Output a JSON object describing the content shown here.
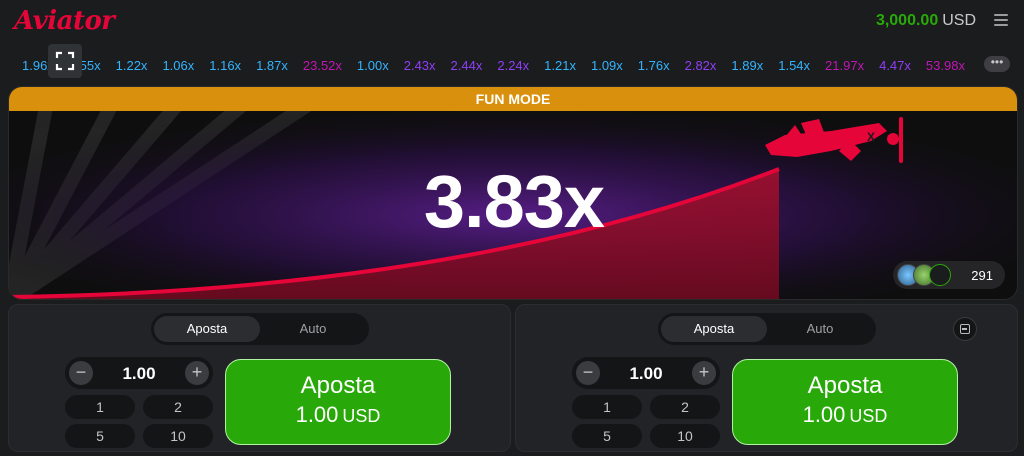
{
  "header": {
    "logo": "Aviator",
    "balance_amount": "3,000.00",
    "balance_currency": "USD"
  },
  "history": [
    {
      "text": "1.96x",
      "color": "#34b4ff"
    },
    {
      "text": "1.55x",
      "color": "#34b4ff"
    },
    {
      "text": "1.22x",
      "color": "#34b4ff"
    },
    {
      "text": "1.06x",
      "color": "#34b4ff"
    },
    {
      "text": "1.16x",
      "color": "#34b4ff"
    },
    {
      "text": "1.87x",
      "color": "#34b4ff"
    },
    {
      "text": "23.52x",
      "color": "#c017b4"
    },
    {
      "text": "1.00x",
      "color": "#34b4ff"
    },
    {
      "text": "2.43x",
      "color": "#913ef8"
    },
    {
      "text": "2.44x",
      "color": "#913ef8"
    },
    {
      "text": "2.24x",
      "color": "#913ef8"
    },
    {
      "text": "1.21x",
      "color": "#34b4ff"
    },
    {
      "text": "1.09x",
      "color": "#34b4ff"
    },
    {
      "text": "1.76x",
      "color": "#34b4ff"
    },
    {
      "text": "2.82x",
      "color": "#913ef8"
    },
    {
      "text": "1.89x",
      "color": "#34b4ff"
    },
    {
      "text": "1.54x",
      "color": "#34b4ff"
    },
    {
      "text": "21.97x",
      "color": "#c017b4"
    },
    {
      "text": "4.47x",
      "color": "#913ef8"
    },
    {
      "text": "53.98x",
      "color": "#c017b4"
    }
  ],
  "game": {
    "mode_banner": "FUN MODE",
    "multiplier": "3.83x",
    "players_count": "291"
  },
  "panels": [
    {
      "tab_bet": "Aposta",
      "tab_auto": "Auto",
      "stake": "1.00",
      "quick": [
        "1",
        "2",
        "5",
        "10"
      ],
      "bet_label": "Aposta",
      "bet_amount": "1.00",
      "bet_currency": "USD"
    },
    {
      "tab_bet": "Aposta",
      "tab_auto": "Auto",
      "stake": "1.00",
      "quick": [
        "1",
        "2",
        "5",
        "10"
      ],
      "bet_label": "Aposta",
      "bet_amount": "1.00",
      "bet_currency": "USD"
    }
  ],
  "colors": {
    "brand": "#e50539",
    "balance": "#28a909",
    "fun_mode": "#d9900d",
    "bet_button": "#28a909"
  },
  "icons": [
    "fullscreen-icon",
    "menu-icon",
    "more-icon",
    "plane-icon",
    "minus-icon",
    "plus-icon",
    "collapse-icon"
  ]
}
